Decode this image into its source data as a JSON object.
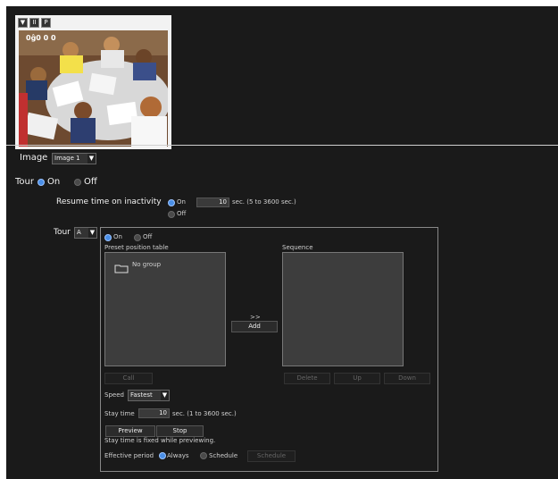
{
  "viewer": {
    "controls": [
      "▼",
      "II",
      "P"
    ],
    "overlay_text": "0ĝ0 0 0"
  },
  "image": {
    "label": "Image",
    "selected": "Image 1"
  },
  "tour": {
    "label": "Tour",
    "on": "On",
    "off": "Off",
    "state": "On"
  },
  "resume": {
    "label": "Resume time on inactivity",
    "on": "On",
    "off": "Off",
    "value": "10",
    "unit": "sec. (5 to 3600 sec.)"
  },
  "tour_select": {
    "label": "Tour",
    "selected": "A"
  },
  "tour_panel": {
    "on": "On",
    "off": "Off",
    "preset_table_label": "Preset position table",
    "folder_label": "No group",
    "sequence_label": "Sequence",
    "add_arrows": ">>",
    "add_label": "Add",
    "call_label": "Call",
    "delete_label": "Delete",
    "up_label": "Up",
    "down_label": "Down",
    "speed_label": "Speed",
    "speed_value": "Fastest",
    "stay_label": "Stay time",
    "stay_value": "10",
    "stay_unit": "sec. (1 to 3600 sec.)",
    "preview_label": "Preview",
    "stop_label": "Stop",
    "note": "Stay time is fixed while previewing.",
    "effective_label": "Effective period",
    "always_label": "Always",
    "schedule_label": "Schedule",
    "schedule_button": "Schedule"
  },
  "colors": {
    "background": "#1a1a1a",
    "accent": "#4a8fe7",
    "panel_border": "#888888"
  }
}
